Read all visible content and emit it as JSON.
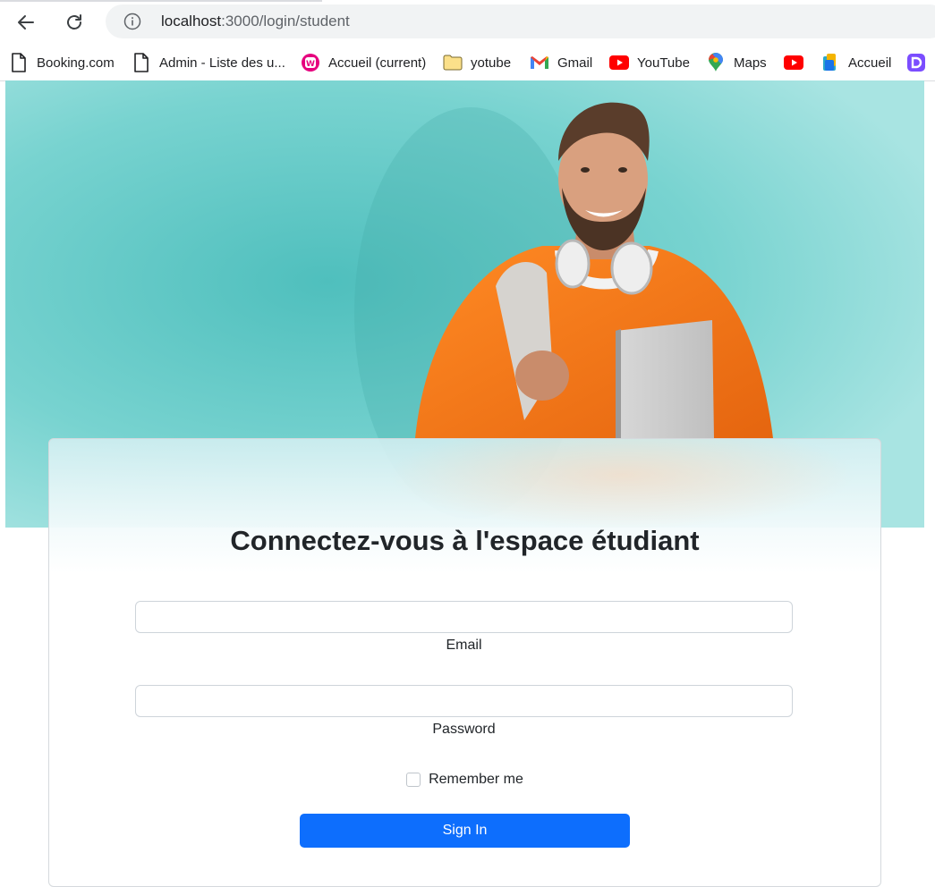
{
  "browser": {
    "url_host": "localhost",
    "url_rest": ":3000/login/student",
    "bookmarks": [
      {
        "label": "Booking.com",
        "icon": "page-icon"
      },
      {
        "label": "Admin - Liste des u...",
        "icon": "page-icon"
      },
      {
        "label": "Accueil (current)",
        "icon": "wamp-icon"
      },
      {
        "label": "yotube",
        "icon": "folder-icon"
      },
      {
        "label": "Gmail",
        "icon": "gmail-icon"
      },
      {
        "label": "YouTube",
        "icon": "youtube-icon"
      },
      {
        "label": "Maps",
        "icon": "maps-icon"
      },
      {
        "label": "",
        "icon": "youtube-icon"
      },
      {
        "label": "Accueil",
        "icon": "app-icon"
      }
    ]
  },
  "login": {
    "title": "Connectez-vous à l'espace étudiant",
    "email_label": "Email",
    "email_value": "",
    "password_label": "Password",
    "password_value": "",
    "remember_label": "Remember me",
    "remember_checked": false,
    "submit_label": "Sign In"
  },
  "colors": {
    "hero_background": "#6fd0cd",
    "primary_button": "#0d6efd",
    "sweater": "#f07a1a"
  }
}
